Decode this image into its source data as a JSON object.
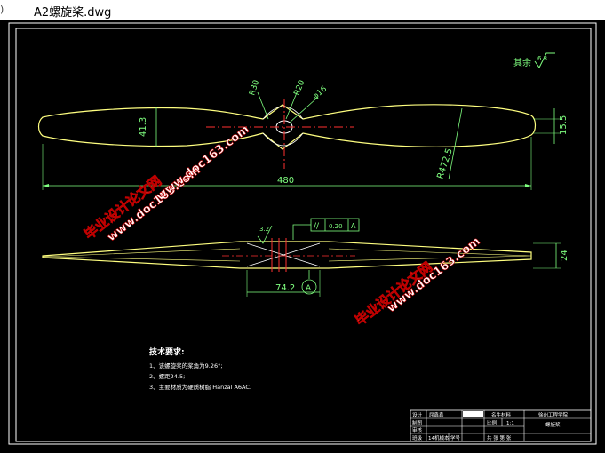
{
  "window": {
    "title": "A2螺旋桨.dwg",
    "edge_glyph": ")"
  },
  "drawing": {
    "roughness_label": "其余",
    "roughness_value": "6.3",
    "dims_top": {
      "r30": "R30",
      "r20": "R20",
      "phi16": "φ16",
      "h413": "41.3",
      "len480": "480",
      "r4725": "R472.5",
      "h155": "15.5"
    },
    "dims_side": {
      "rough32": "3.2",
      "tol_sym": "//",
      "tol_val": "0.20",
      "tol_datum": "A",
      "len742": "74.2",
      "datum_a": "A",
      "h24": "24"
    },
    "tech": {
      "heading": "技术要求:",
      "line1": "1、该螺旋桨的桨角为9.26°;",
      "line2": "2、螺距24.5;",
      "line3": "3、主要材质为硬质树脂 Hanzal A6AC."
    },
    "watermarks": {
      "cn": "毕业设计论文网",
      "url": "www.doc163.com"
    },
    "title_block": {
      "r1c1": "设计",
      "r1c2": "屈鑫鑫",
      "r2c1": "制图",
      "r3c1": "审核",
      "r4c1": "班级",
      "r4c2": "14机械本",
      "r4c3": "学号",
      "material": "名牛材料",
      "school": "徐州工程学院",
      "scale_label": "比例",
      "scale_value": "1:1",
      "part_name": "螺旋桨",
      "sheet_text": "共  张  第  张"
    }
  }
}
